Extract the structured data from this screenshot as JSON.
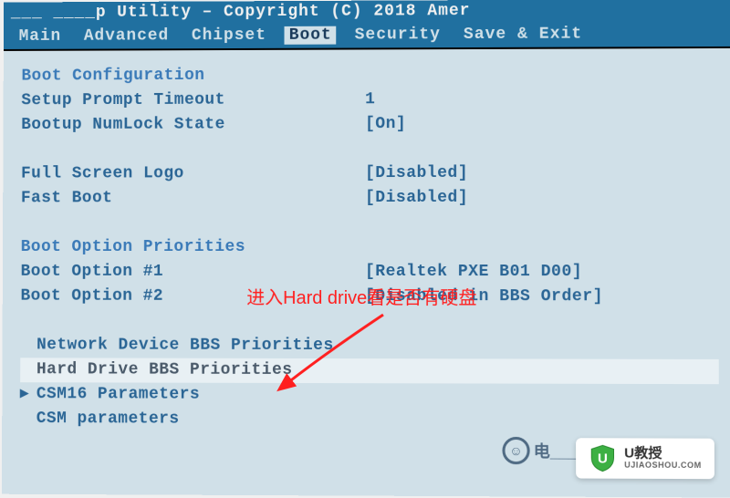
{
  "title_bar": "___ ____p Utility – Copyright (C) 2018 Amer",
  "menu": {
    "items": [
      "Main",
      "Advanced",
      "Chipset",
      "Boot",
      "Security",
      "Save & Exit"
    ],
    "selected": "Boot"
  },
  "content": {
    "section1": "Boot Configuration",
    "prompt_timeout": {
      "label": "Setup Prompt Timeout",
      "value": "1"
    },
    "numlock_state": {
      "label": "Bootup NumLock State",
      "value": "[On]"
    },
    "full_screen_logo": {
      "label": "Full Screen Logo",
      "value": "[Disabled]"
    },
    "fast_boot": {
      "label": "Fast Boot",
      "value": "[Disabled]"
    },
    "section2": "Boot Option Priorities",
    "boot_option_1": {
      "label": "Boot Option #1",
      "value": "[Realtek PXE B01 D00]"
    },
    "boot_option_2": {
      "label": "Boot Option #2",
      "value": "[Disabled in BBS Order]"
    },
    "submenu1": "Network Device BBS Priorities",
    "submenu2": "Hard Drive BBS Priorities",
    "submenu3": "CSM16 Parameters",
    "submenu4": "CSM parameters"
  },
  "annotation": "进入Hard drive看是否有硬盘",
  "watermark": {
    "main": "U教授",
    "sub": "UJIAOSHOU.COM",
    "corner": "电___统_"
  }
}
